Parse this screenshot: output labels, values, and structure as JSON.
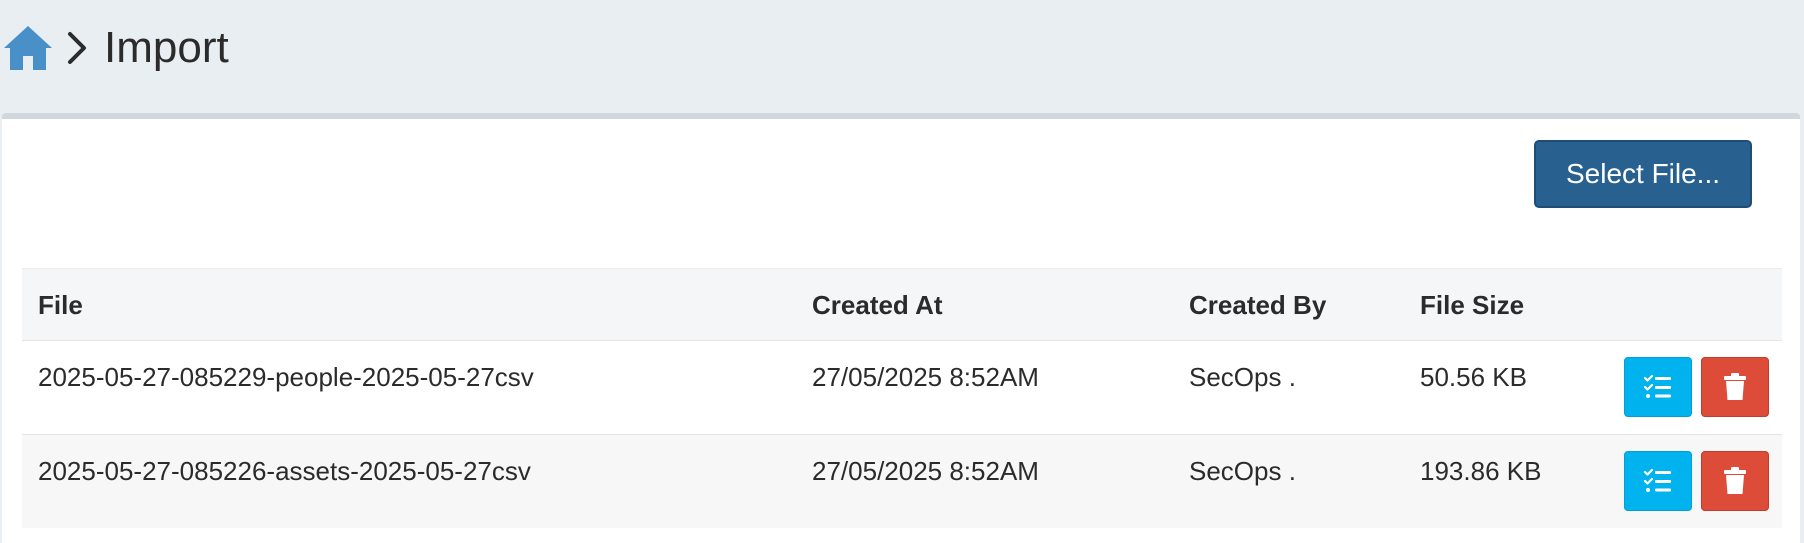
{
  "header": {
    "title": "Import",
    "home_icon": "home-icon",
    "separator_icon": "chevron-right-icon"
  },
  "toolbar": {
    "select_file_label": "Select File..."
  },
  "table": {
    "columns": [
      "File",
      "Created At",
      "Created By",
      "File Size"
    ],
    "rows": [
      {
        "file": "2025-05-27-085229-people-2025-05-27csv",
        "created_at": "27/05/2025 8:52AM",
        "created_by": "SecOps .",
        "file_size": "50.56 KB"
      },
      {
        "file": "2025-05-27-085226-assets-2025-05-27csv",
        "created_at": "27/05/2025 8:52AM",
        "created_by": "SecOps .",
        "file_size": "193.86 KB"
      }
    ],
    "row_actions": [
      "list-check-icon",
      "trash-icon"
    ]
  },
  "colors": {
    "header_bg": "#e9eef3",
    "home_icon": "#4a90c8",
    "select_button": "#286090",
    "view_button": "#00b3ee",
    "delete_button": "#dd4b39"
  }
}
